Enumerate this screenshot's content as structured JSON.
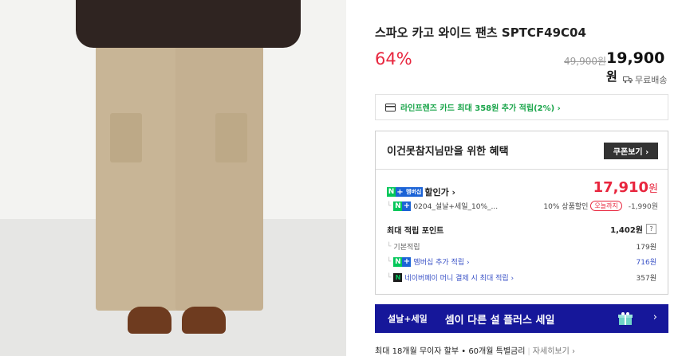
{
  "product": {
    "title": "스파오 카고 와이드 팬츠 SPTCF49C04",
    "discount": "64%",
    "original_price": "49,900원",
    "sale_price_number": "19,900",
    "sale_price_unit": "원",
    "shipping": "무료배송"
  },
  "card_promo": {
    "text": "라인프렌즈 카드 최대 358원 추가 적립(2%) ›"
  },
  "benefit": {
    "heading": "이건못참지님만을 위한 혜택",
    "coupon_button": "쿠폰보기 ›",
    "member_label": "멤버십",
    "discount_label": "할인가 ›",
    "discount_price_number": "17,910",
    "discount_price_unit": "원",
    "sub_desc": "0204_설날+세일_10%_...",
    "sub_pct": "10% 상품할인",
    "sub_today": "오늘까지",
    "sub_amount": "-1,990원",
    "point_heading": "최대 적립 포인트",
    "point_total": "1,402원",
    "help": "?",
    "rows": [
      {
        "label": "기본적립",
        "amount": "179원"
      },
      {
        "label": "멤버십 추가 적립 ›",
        "amount": "716원"
      },
      {
        "label": "네이버페이 머니 결제 시 최대 적립 ›",
        "amount": "357원"
      }
    ]
  },
  "banner": {
    "tag": "설날+세일",
    "text": "셈이 다른 설 플러스 세일",
    "chevron": "›"
  },
  "installment": {
    "text": "최대 18개월 무이자 할부 • 60개월 특별금리",
    "separator": "|",
    "more": "자세히보기 ›"
  }
}
